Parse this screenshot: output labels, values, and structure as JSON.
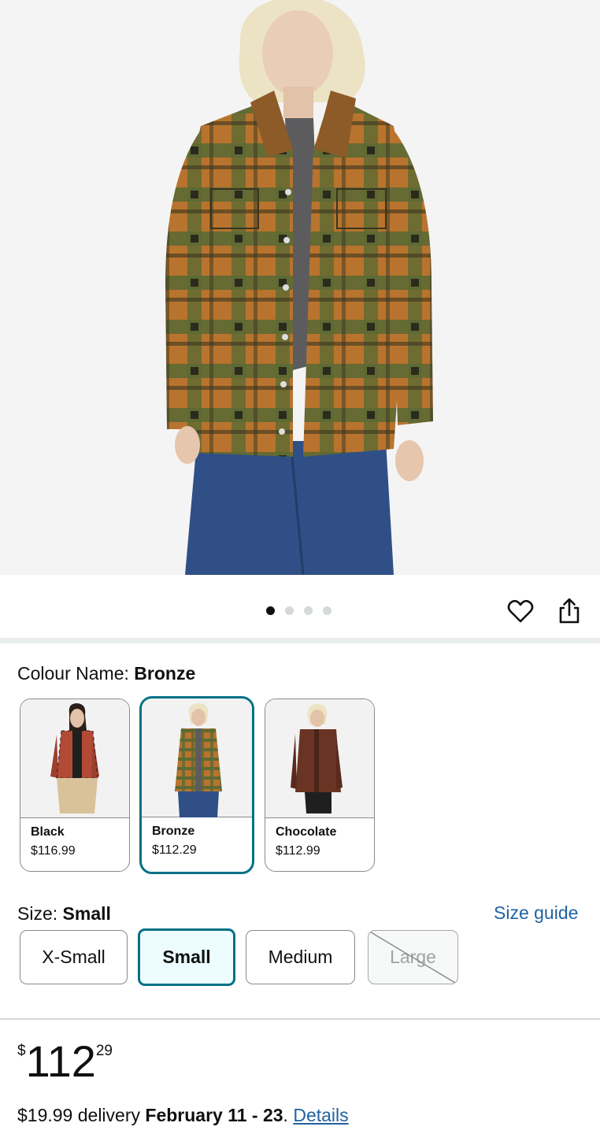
{
  "product_image": {
    "alt": "Model wearing plaid sherpa shirt jacket",
    "page_count": 4,
    "active_page": 1
  },
  "actions": {
    "wishlist_icon": "heart-icon",
    "share_icon": "share-icon"
  },
  "colour": {
    "label": "Colour Name: ",
    "selected": "Bronze",
    "options": [
      {
        "name": "Black",
        "price": "$116.99"
      },
      {
        "name": "Bronze",
        "price": "$112.29"
      },
      {
        "name": "Chocolate",
        "price": "$112.99"
      }
    ]
  },
  "size": {
    "label": "Size: ",
    "selected": "Small",
    "guide_link": "Size guide",
    "options": [
      {
        "label": "X-Small",
        "available": true
      },
      {
        "label": "Small",
        "available": true
      },
      {
        "label": "Medium",
        "available": true
      },
      {
        "label": "Large",
        "available": false
      }
    ]
  },
  "price": {
    "symbol": "$",
    "whole": "112",
    "fraction": "29"
  },
  "delivery": {
    "prefix": "$19.99 delivery ",
    "dates": "February 11 - 23",
    "separator": ". ",
    "details_link": "Details"
  },
  "colors": {
    "accent": "#007185",
    "link": "#2162a1",
    "selected_fill": "#edfdff"
  }
}
